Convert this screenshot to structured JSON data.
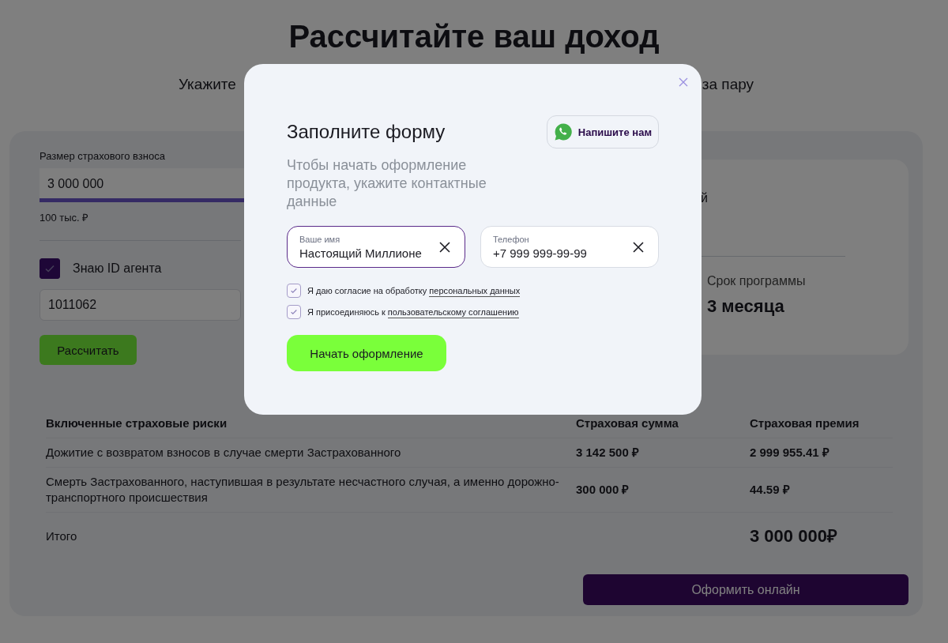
{
  "page": {
    "title": "Рассчитайте ваш доход",
    "subtitle_parts": [
      "Укажите",
      "за пару"
    ]
  },
  "calculator": {
    "premium_label": "Размер страхового взноса",
    "premium_value": "3 000 000",
    "premium_min": "100 тыс. ₽",
    "agent": {
      "label": "Знаю ID агента",
      "checked": true,
      "value": "1011062"
    },
    "calculate_button": "Рассчитать"
  },
  "result": {
    "partial_text": "й",
    "term_label": "Срок программы",
    "term_value": "3 месяца"
  },
  "table": {
    "columns": [
      "Включенные страховые риски",
      "Страховая сумма",
      "Страховая премия"
    ],
    "rows": [
      {
        "risk": "Дожитие с возвратом взносов в случае смерти Застрахованного",
        "sum": "3 142 500 ₽",
        "premium": "2 999 955.41 ₽"
      },
      {
        "risk": "Смерть Застрахованного, наступившая в результате несчастного случая, а именно дорожно-транспортного происшествия",
        "sum": "300 000 ₽",
        "premium": "44.59 ₽"
      }
    ],
    "total": {
      "label": "Итого",
      "value": "3 000 000₽"
    }
  },
  "apply_button": "Оформить онлайн",
  "modal": {
    "title": "Заполните форму",
    "contact_button": "Напишите нам",
    "description": "Чтобы начать оформление продукта, укажите контактные данные",
    "fields": [
      {
        "label": "Ваше имя",
        "value": "Настоящий Миллионе",
        "focused": true
      },
      {
        "label": "Телефон",
        "value": "+7 999 999-99-99",
        "focused": false
      }
    ],
    "consents": [
      {
        "text": "Я даю согласие на обработку",
        "link": "персональных данных",
        "checked": true
      },
      {
        "text": "Я присоединяюсь к",
        "link": "пользовательскому соглашению",
        "checked": true
      }
    ],
    "submit_button": "Начать оформление"
  }
}
